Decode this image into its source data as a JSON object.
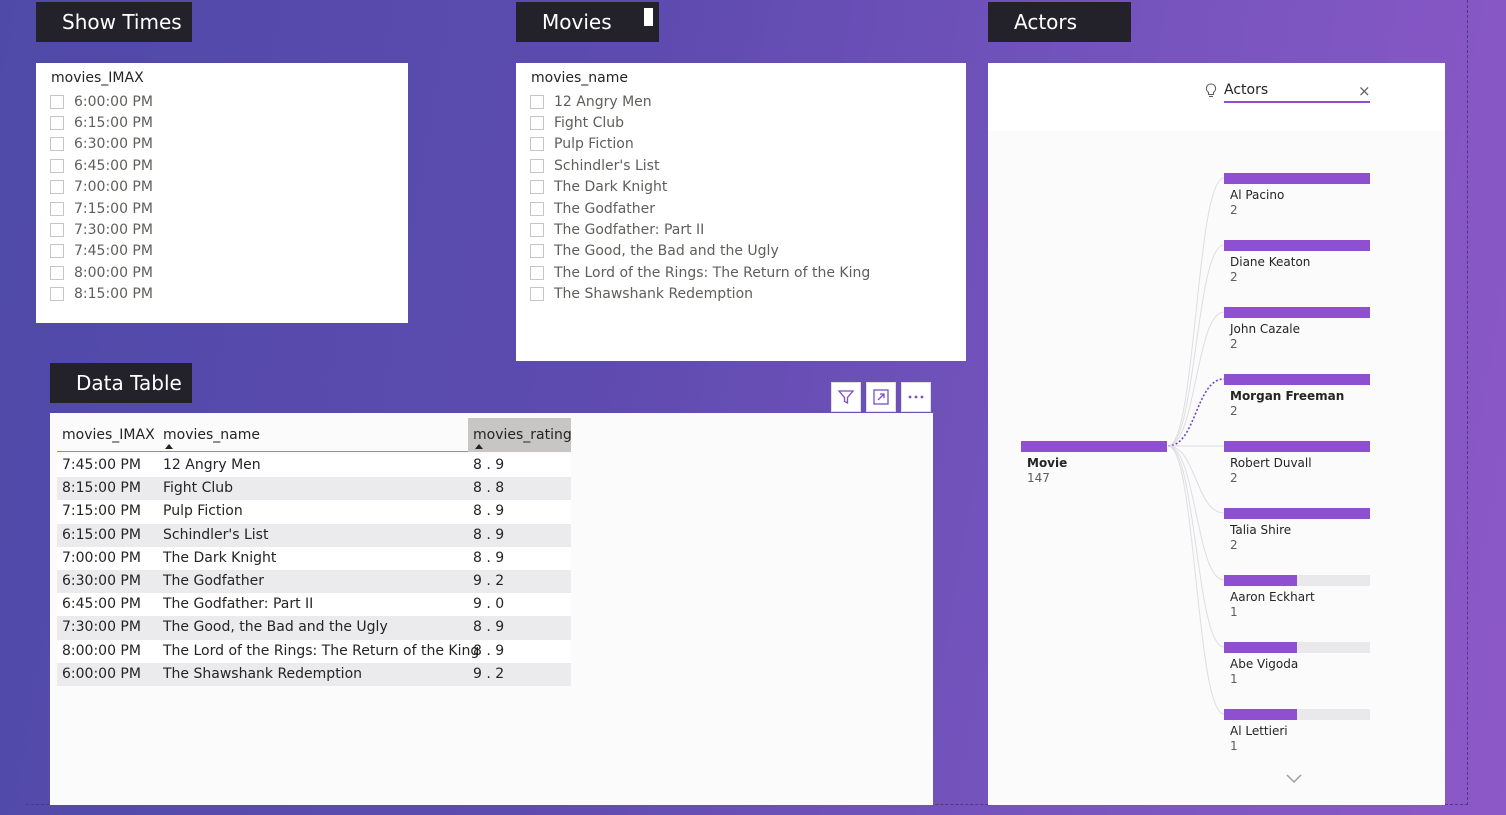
{
  "tabs": {
    "show_times": "Show Times",
    "movies": "Movies",
    "actors": "Actors",
    "data_table": "Data Table"
  },
  "show_times_slicer": {
    "header": "movies_IMAX",
    "items": [
      "6:00:00 PM",
      "6:15:00 PM",
      "6:30:00 PM",
      "6:45:00 PM",
      "7:00:00 PM",
      "7:15:00 PM",
      "7:30:00 PM",
      "7:45:00 PM",
      "8:00:00 PM",
      "8:15:00 PM"
    ]
  },
  "movies_slicer": {
    "header": "movies_name",
    "items": [
      "12 Angry Men",
      "Fight Club",
      "Pulp Fiction",
      "Schindler's List",
      "The Dark Knight",
      "The Godfather",
      "The Godfather: Part II",
      "The Good, the Bad and the Ugly",
      "The Lord of the Rings: The Return of the King",
      "The Shawshank Redemption"
    ]
  },
  "data_table": {
    "columns": [
      "movies_IMAX",
      "movies_name",
      "movies_rating"
    ],
    "rows": [
      [
        "7:45:00 PM",
        "12 Angry Men",
        "8 . 9"
      ],
      [
        "8:15:00 PM",
        "Fight Club",
        "8 . 8"
      ],
      [
        "7:15:00 PM",
        "Pulp Fiction",
        "8 . 9"
      ],
      [
        "6:15:00 PM",
        "Schindler's List",
        "8 . 9"
      ],
      [
        "7:00:00 PM",
        "The Dark Knight",
        "8 . 9"
      ],
      [
        "6:30:00 PM",
        "The Godfather",
        "9 . 2"
      ],
      [
        "6:45:00 PM",
        "The Godfather: Part II",
        "9 . 0"
      ],
      [
        "7:30:00 PM",
        "The Good, the Bad and the Ugly",
        "8 . 9"
      ],
      [
        "8:00:00 PM",
        "The Lord of the Rings: The Return of the King",
        "8 . 9"
      ],
      [
        "6:00:00 PM",
        "The Shawshank Redemption",
        "9 . 2"
      ]
    ]
  },
  "decomposition_tree": {
    "level_header": "Actors",
    "root": {
      "label": "Movie",
      "value": "147"
    },
    "nodes": [
      {
        "label": "Al Pacino",
        "value": "2",
        "fill": 1.0
      },
      {
        "label": "Diane Keaton",
        "value": "2",
        "fill": 1.0
      },
      {
        "label": "John Cazale",
        "value": "2",
        "fill": 1.0
      },
      {
        "label": "Morgan Freeman",
        "value": "2",
        "fill": 1.0,
        "selected": true
      },
      {
        "label": "Robert Duvall",
        "value": "2",
        "fill": 1.0
      },
      {
        "label": "Talia Shire",
        "value": "2",
        "fill": 1.0
      },
      {
        "label": "Aaron Eckhart",
        "value": "1",
        "fill": 0.5
      },
      {
        "label": "Abe Vigoda",
        "value": "1",
        "fill": 0.5
      },
      {
        "label": "Al Lettieri",
        "value": "1",
        "fill": 0.5
      }
    ]
  },
  "colors": {
    "accent": "#8e4fd1",
    "bar_track": "#e9e8eb",
    "tab_bg": "#23222b"
  }
}
